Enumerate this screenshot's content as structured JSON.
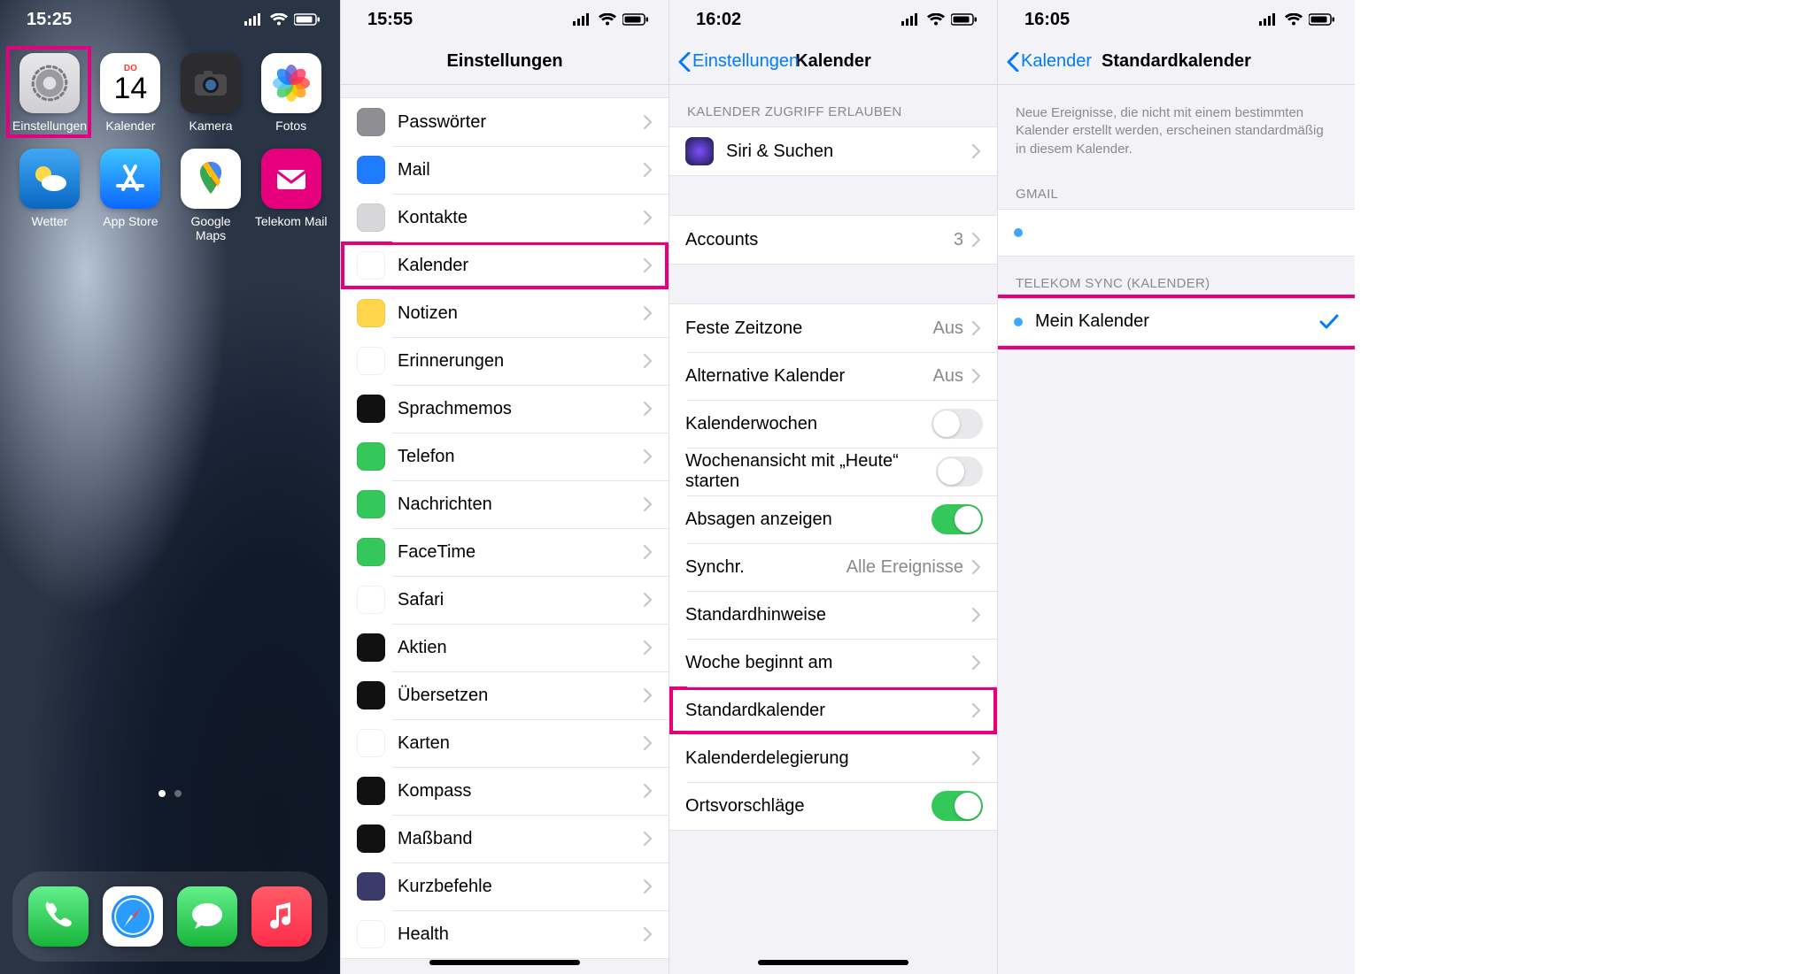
{
  "screen0": {
    "time": "15:25",
    "apps": [
      {
        "id": "settings",
        "label": "Einstellungen"
      },
      {
        "id": "calendar",
        "label": "Kalender",
        "weekday": "DO",
        "day": "14"
      },
      {
        "id": "camera",
        "label": "Kamera"
      },
      {
        "id": "photos",
        "label": "Fotos"
      },
      {
        "id": "weather",
        "label": "Wetter"
      },
      {
        "id": "appstore",
        "label": "App Store"
      },
      {
        "id": "gmaps",
        "label": "Google Maps"
      },
      {
        "id": "tmail",
        "label": "Telekom Mail"
      }
    ],
    "dock": [
      {
        "id": "phone"
      },
      {
        "id": "safari"
      },
      {
        "id": "messages"
      },
      {
        "id": "music"
      }
    ]
  },
  "screen1": {
    "time": "15:55",
    "title": "Einstellungen",
    "items": [
      {
        "label": "Passwörter",
        "color": "#8e8e93"
      },
      {
        "label": "Mail",
        "color": "#1f7cff"
      },
      {
        "label": "Kontakte",
        "color": "#d7d7da"
      },
      {
        "label": "Kalender",
        "color": "#ffffff",
        "highlight": true
      },
      {
        "label": "Notizen",
        "color": "#ffd54a"
      },
      {
        "label": "Erinnerungen",
        "color": "#ffffff"
      },
      {
        "label": "Sprachmemos",
        "color": "#111"
      },
      {
        "label": "Telefon",
        "color": "#34c759"
      },
      {
        "label": "Nachrichten",
        "color": "#34c759"
      },
      {
        "label": "FaceTime",
        "color": "#34c759"
      },
      {
        "label": "Safari",
        "color": "#ffffff"
      },
      {
        "label": "Aktien",
        "color": "#111"
      },
      {
        "label": "Übersetzen",
        "color": "#111"
      },
      {
        "label": "Karten",
        "color": "#ffffff"
      },
      {
        "label": "Kompass",
        "color": "#111"
      },
      {
        "label": "Maßband",
        "color": "#111"
      },
      {
        "label": "Kurzbefehle",
        "color": "#3b3b6b"
      },
      {
        "label": "Health",
        "color": "#ffffff"
      }
    ]
  },
  "screen2": {
    "time": "16:02",
    "back": "Einstellungen",
    "title": "Kalender",
    "section_access": "KALENDER ZUGRIFF ERLAUBEN",
    "siri": {
      "label": "Siri & Suchen"
    },
    "accounts": {
      "label": "Accounts",
      "value": "3"
    },
    "rows": [
      {
        "label": "Feste Zeitzone",
        "value": "Aus",
        "type": "link"
      },
      {
        "label": "Alternative Kalender",
        "value": "Aus",
        "type": "link"
      },
      {
        "label": "Kalenderwochen",
        "type": "toggle",
        "on": false
      },
      {
        "label": "Wochenansicht mit „Heute“ starten",
        "type": "toggle",
        "on": false
      },
      {
        "label": "Absagen anzeigen",
        "type": "toggle",
        "on": true
      },
      {
        "label": "Synchr.",
        "value": "Alle Ereignisse",
        "type": "link"
      },
      {
        "label": "Standardhinweise",
        "type": "link"
      },
      {
        "label": "Woche beginnt am",
        "type": "link"
      },
      {
        "label": "Standardkalender",
        "type": "link",
        "highlight": true
      },
      {
        "label": "Kalenderdelegierung",
        "type": "link"
      },
      {
        "label": "Ortsvorschläge",
        "type": "toggle",
        "on": true
      }
    ]
  },
  "screen3": {
    "time": "16:05",
    "back": "Kalender",
    "title": "Standardkalender",
    "desc": "Neue Ereignisse, die nicht mit einem bestimmten Kalender erstellt werden, erscheinen standardmäßig in diesem Kalender.",
    "groups": [
      {
        "header": "GMAIL",
        "items": [
          {
            "label": "",
            "checked": false
          }
        ]
      },
      {
        "header": "TELEKOM SYNC (KALENDER)",
        "items": [
          {
            "label": "Mein Kalender",
            "checked": true
          }
        ],
        "highlight": true
      }
    ]
  }
}
